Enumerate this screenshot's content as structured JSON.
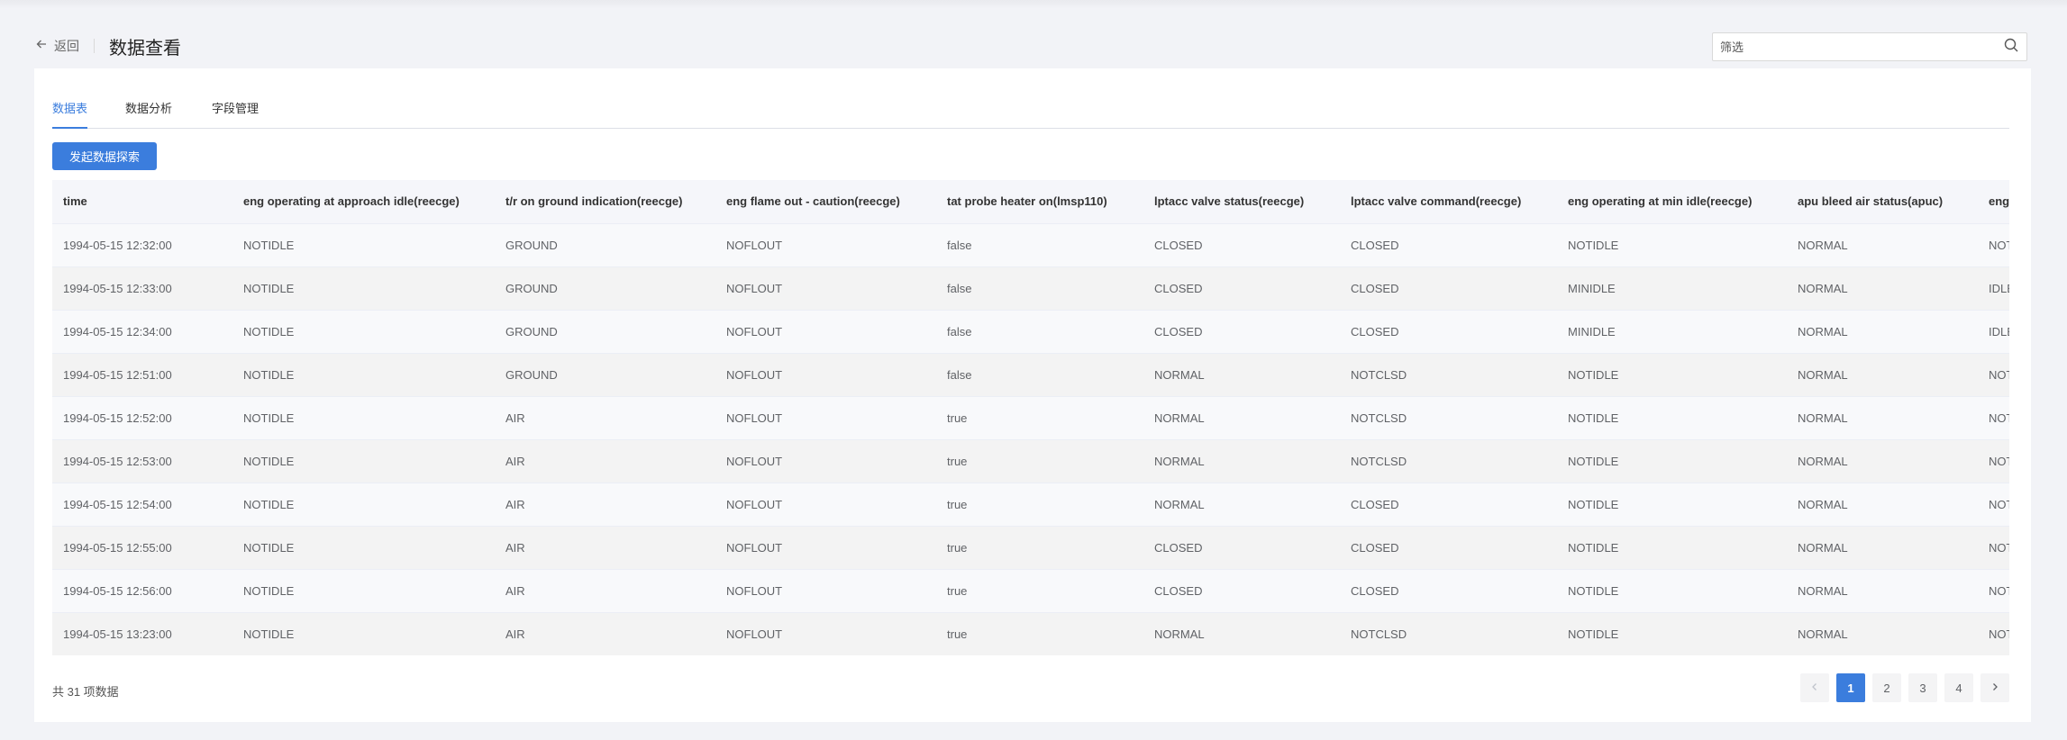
{
  "header": {
    "back_label": "返回",
    "title": "数据查看",
    "filter_placeholder": "筛选"
  },
  "tabs": [
    {
      "label": "数据表",
      "active": true
    },
    {
      "label": "数据分析",
      "active": false
    },
    {
      "label": "字段管理",
      "active": false
    }
  ],
  "explore_button": "发起数据探索",
  "table": {
    "columns": [
      "time",
      "eng operating at approach idle(reecge)",
      "t/r on ground indication(reecge)",
      "eng flame out - caution(reecge)",
      "tat probe heater on(lmsp110)",
      "lptacc valve status(reecge)",
      "lptacc valve command(reecge)",
      "eng operating at min idle(reecge)",
      "apu bleed air status(apuc)",
      "eng"
    ],
    "rows": [
      [
        "1994-05-15 12:32:00",
        "NOTIDLE",
        "GROUND",
        "NOFLOUT",
        "false",
        "CLOSED",
        "CLOSED",
        "NOTIDLE",
        "NORMAL",
        "NOT"
      ],
      [
        "1994-05-15 12:33:00",
        "NOTIDLE",
        "GROUND",
        "NOFLOUT",
        "false",
        "CLOSED",
        "CLOSED",
        "MINIDLE",
        "NORMAL",
        "IDLE"
      ],
      [
        "1994-05-15 12:34:00",
        "NOTIDLE",
        "GROUND",
        "NOFLOUT",
        "false",
        "CLOSED",
        "CLOSED",
        "MINIDLE",
        "NORMAL",
        "IDLE"
      ],
      [
        "1994-05-15 12:51:00",
        "NOTIDLE",
        "GROUND",
        "NOFLOUT",
        "false",
        "NORMAL",
        "NOTCLSD",
        "NOTIDLE",
        "NORMAL",
        "NOT"
      ],
      [
        "1994-05-15 12:52:00",
        "NOTIDLE",
        "AIR",
        "NOFLOUT",
        "true",
        "NORMAL",
        "NOTCLSD",
        "NOTIDLE",
        "NORMAL",
        "NOT"
      ],
      [
        "1994-05-15 12:53:00",
        "NOTIDLE",
        "AIR",
        "NOFLOUT",
        "true",
        "NORMAL",
        "NOTCLSD",
        "NOTIDLE",
        "NORMAL",
        "NOT"
      ],
      [
        "1994-05-15 12:54:00",
        "NOTIDLE",
        "AIR",
        "NOFLOUT",
        "true",
        "NORMAL",
        "CLOSED",
        "NOTIDLE",
        "NORMAL",
        "NOT"
      ],
      [
        "1994-05-15 12:55:00",
        "NOTIDLE",
        "AIR",
        "NOFLOUT",
        "true",
        "CLOSED",
        "CLOSED",
        "NOTIDLE",
        "NORMAL",
        "NOT"
      ],
      [
        "1994-05-15 12:56:00",
        "NOTIDLE",
        "AIR",
        "NOFLOUT",
        "true",
        "CLOSED",
        "CLOSED",
        "NOTIDLE",
        "NORMAL",
        "NOT"
      ],
      [
        "1994-05-15 13:23:00",
        "NOTIDLE",
        "AIR",
        "NOFLOUT",
        "true",
        "NORMAL",
        "NOTCLSD",
        "NOTIDLE",
        "NORMAL",
        "NOT"
      ]
    ]
  },
  "footer": {
    "total_text": "共 31 项数据",
    "pages": [
      "1",
      "2",
      "3",
      "4"
    ],
    "current_page": "1"
  },
  "colors": {
    "accent": "#3b7ddd",
    "background": "#f2f3f7"
  },
  "icons": [
    "arrow-left-icon",
    "search-icon",
    "chevron-left-icon",
    "chevron-right-icon"
  ]
}
